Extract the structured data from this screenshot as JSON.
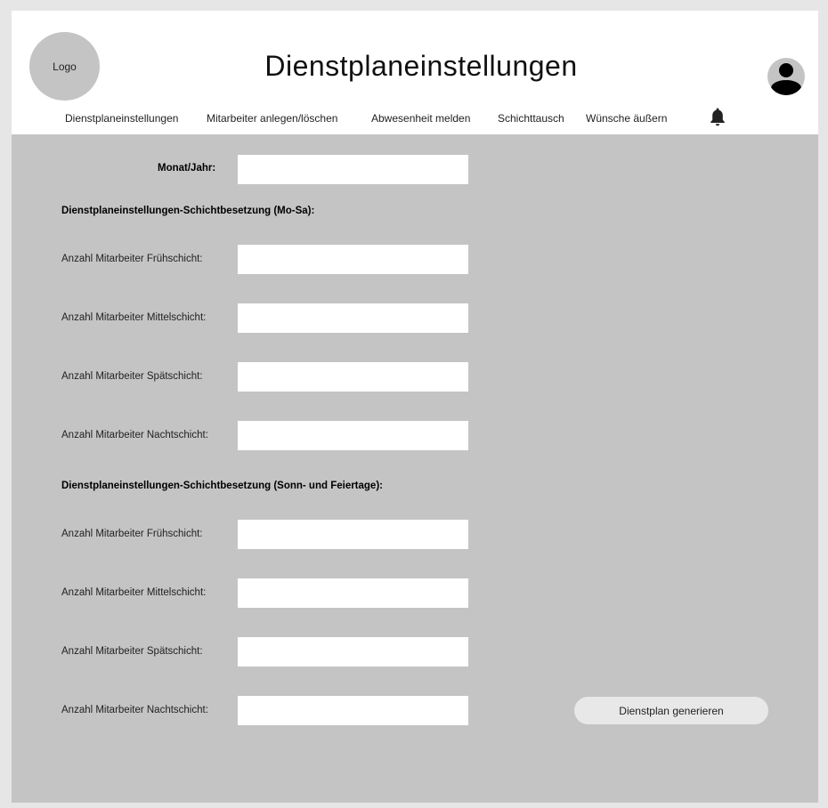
{
  "header": {
    "logo_text": "Logo",
    "title": "Dienstplaneinstellungen"
  },
  "nav": {
    "items": [
      "Dienstplaneinstellungen",
      "Mitarbeiter anlegen/löschen",
      "Abwesenheit melden",
      "Schichttausch",
      "Wünsche äußern"
    ]
  },
  "form": {
    "month_year_label": "Monat/Jahr:",
    "weekday_section": {
      "title": "Dienstplaneinstellungen-Schichtbesetzung (Mo-Sa):",
      "fields": [
        "Anzahl Mitarbeiter Frühschicht:",
        "Anzahl Mitarbeiter Mittelschicht:",
        "Anzahl Mitarbeiter Spätschicht:",
        "Anzahl Mitarbeiter Nachtschicht:"
      ]
    },
    "holiday_section": {
      "title": "Dienstplaneinstellungen-Schichtbesetzung (Sonn- und Feiertage):",
      "fields": [
        "Anzahl Mitarbeiter Frühschicht:",
        "Anzahl Mitarbeiter Mittelschicht:",
        "Anzahl Mitarbeiter Spätschicht:",
        "Anzahl Mitarbeiter Nachtschicht:"
      ]
    }
  },
  "actions": {
    "generate_label": "Dienstplan generieren"
  }
}
